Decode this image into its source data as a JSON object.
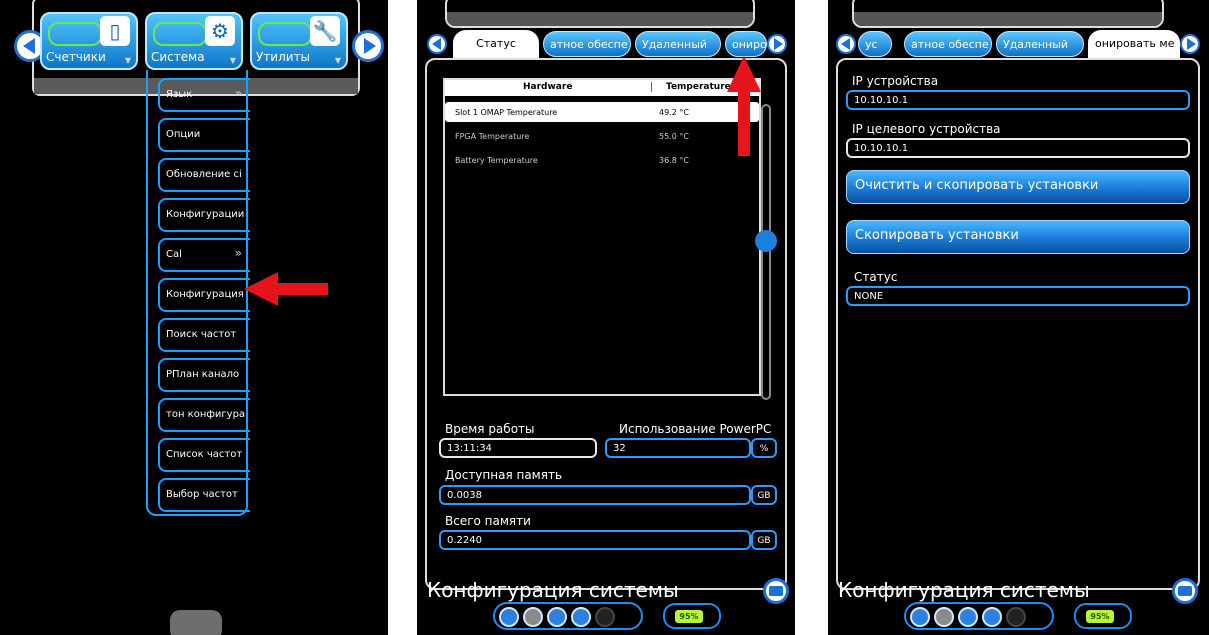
{
  "screen1": {
    "tiles": [
      {
        "label": "Счетчики",
        "icon": "counter-icon"
      },
      {
        "label": "Система",
        "icon": "gear-icon"
      },
      {
        "label": "Утилиты",
        "icon": "wrench-icon"
      }
    ],
    "menu_items": [
      {
        "label": "Язык",
        "submenu": true
      },
      {
        "label": "Опции",
        "submenu": false
      },
      {
        "label": "Обновление сі",
        "submenu": false
      },
      {
        "label": "Конфигурации",
        "submenu": false
      },
      {
        "label": "Cal",
        "submenu": true
      },
      {
        "label": "Конфигурация",
        "submenu": false
      },
      {
        "label": "Поиск частот",
        "submenu": false
      },
      {
        "label": "РПлан канало",
        "submenu": false
      },
      {
        "label": "тон конфигура",
        "submenu": false
      },
      {
        "label": "Список частот",
        "submenu": false
      },
      {
        "label": "Выбор частот",
        "submenu": false
      }
    ],
    "submenu_glyph": "»"
  },
  "screen2": {
    "tabs": [
      "Статус",
      "атное обеспе",
      "Удаленный",
      "ониро"
    ],
    "table": {
      "headers": [
        "Hardware",
        "Temperature"
      ],
      "rows": [
        {
          "hardware": "Slot 1 OMAP Temperature",
          "temperature": "49.2 °C"
        },
        {
          "hardware": "FPGA Temperature",
          "temperature": "55.0 °C"
        },
        {
          "hardware": "Battery Temperature",
          "temperature": "36.8 °C"
        }
      ]
    },
    "uptime_label": "Время работы",
    "uptime_value": "13:11:34",
    "cpu_label": "Использование PowerPC",
    "cpu_value": "32",
    "cpu_unit": "%",
    "free_mem_label": "Доступная память",
    "free_mem_value": "0.0038",
    "free_mem_unit": "GB",
    "total_mem_label": "Всего памяти",
    "total_mem_value": "0.2240",
    "total_mem_unit": "GB",
    "title": "Конфигурация системы",
    "battery": "95%"
  },
  "screen3": {
    "tabs": [
      "ус",
      "атное обеспе",
      "Удаленный",
      "онировать ме"
    ],
    "ip_device_label": "IP устройства",
    "ip_device_value": "10.10.10.1",
    "ip_target_label": "IP целевого устройства",
    "ip_target_value": "10.10.10.1",
    "clear_copy_button": "Очистить и скопировать установки",
    "copy_button": "Скопировать установки",
    "status_label": "Статус",
    "status_value": "NONE",
    "title": "Конфигурация системы",
    "battery": "95%"
  },
  "colors": {
    "accent": "#1aa0ff",
    "annotation_arrow": "#e8141b",
    "battery": "#b6f53a"
  }
}
